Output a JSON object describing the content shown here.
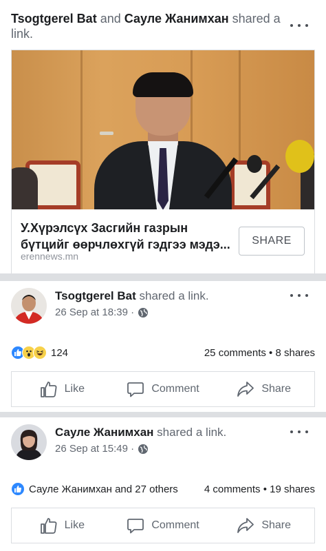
{
  "post1": {
    "author1": "Tsogtgerel Bat",
    "joiner": "and",
    "author2": "Сауле Жанимхан",
    "action_text": "shared a link.",
    "link": {
      "title": "У.Хүрэлсүх Засгийн газрын бүтцийг өөрчлөхгүй гэдгээ мэдэ...",
      "domain": "erennews.mn",
      "button_label": "SHARE"
    }
  },
  "post2": {
    "author": "Tsogtgerel Bat",
    "action_text": "shared a link.",
    "timestamp": "26 Sep at 18:39 ·",
    "reaction_count": "124",
    "counts": "25 comments • 8 shares",
    "actions": {
      "like": "Like",
      "comment": "Comment",
      "share": "Share"
    }
  },
  "post3": {
    "author": "Сауле Жанимхан",
    "action_text": "shared a link.",
    "timestamp": "26 Sep at 15:49 ·",
    "reaction_text": "Сауле Жанимхан and 27 others",
    "counts": "4 comments • 19 shares",
    "actions": {
      "like": "Like",
      "comment": "Comment",
      "share": "Share"
    }
  },
  "icons": [
    "more-options-icon",
    "globe-icon",
    "like-reaction-icon",
    "wow-reaction-icon",
    "haha-reaction-icon",
    "like-icon",
    "comment-icon",
    "share-icon"
  ],
  "colors": {
    "accent": "#2d88ff",
    "text": "#1c1e21",
    "secondary": "#616770",
    "divider": "#dddfe2"
  }
}
